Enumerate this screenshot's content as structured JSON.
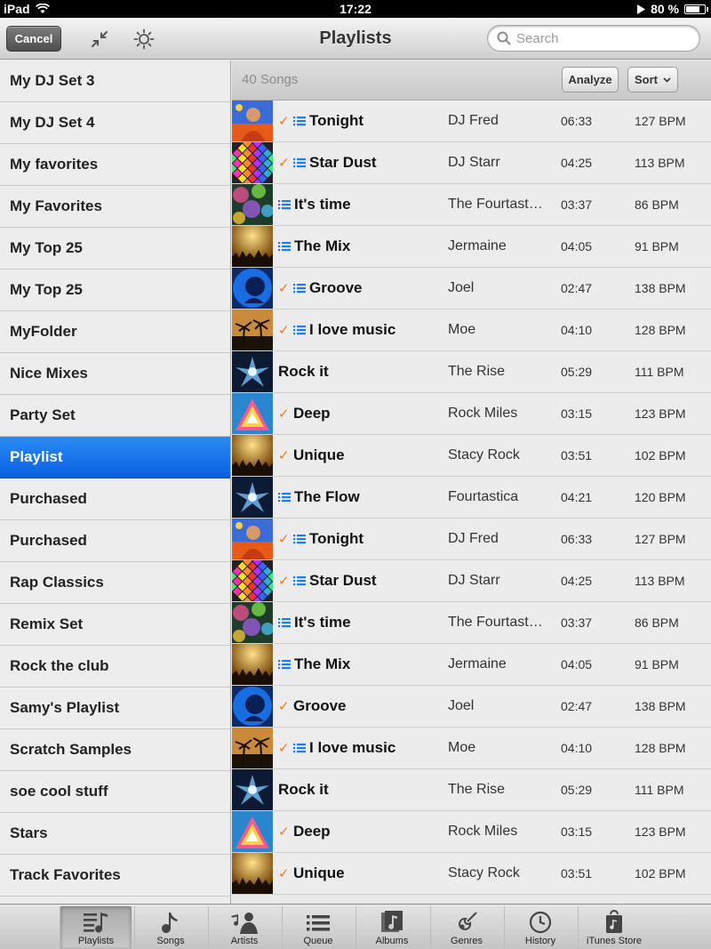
{
  "status": {
    "device": "iPad",
    "time": "17:22",
    "battery": "80 %",
    "battery_level": 0.8
  },
  "nav": {
    "cancel_label": "Cancel",
    "title": "Playlists",
    "search_placeholder": "Search"
  },
  "sidebar": {
    "items": [
      {
        "label": "My DJ Set 3"
      },
      {
        "label": "My DJ Set 4"
      },
      {
        "label": "My favorites"
      },
      {
        "label": "My Favorites"
      },
      {
        "label": "My Top 25"
      },
      {
        "label": "My Top 25"
      },
      {
        "label": "MyFolder"
      },
      {
        "label": "Nice Mixes"
      },
      {
        "label": "Party Set"
      },
      {
        "label": "Playlist",
        "selected": true
      },
      {
        "label": "Purchased"
      },
      {
        "label": "Purchased"
      },
      {
        "label": "Rap Classics"
      },
      {
        "label": "Remix Set"
      },
      {
        "label": "Rock the club"
      },
      {
        "label": "Samy's Playlist"
      },
      {
        "label": "Scratch Samples"
      },
      {
        "label": "soe cool stuff"
      },
      {
        "label": "Stars"
      },
      {
        "label": "Track Favorites"
      }
    ]
  },
  "main": {
    "song_count": "40 Songs",
    "analyze_label": "Analyze",
    "sort_label": "Sort",
    "songs": [
      {
        "title": "Tonight",
        "artist": "DJ Fred",
        "duration": "06:33",
        "bpm": "127 BPM",
        "checked": true,
        "listed": true,
        "art": "person-orange"
      },
      {
        "title": "Star Dust",
        "artist": "DJ Starr",
        "duration": "04:25",
        "bpm": "113 BPM",
        "checked": true,
        "listed": true,
        "art": "mosaic"
      },
      {
        "title": "It's time",
        "artist": "The Fourtast…",
        "duration": "03:37",
        "bpm": "86 BPM",
        "checked": false,
        "listed": true,
        "art": "bokeh"
      },
      {
        "title": "The Mix",
        "artist": "Jermaine",
        "duration": "04:05",
        "bpm": "91 BPM",
        "checked": false,
        "listed": true,
        "art": "crowd"
      },
      {
        "title": "Groove",
        "artist": "Joel",
        "duration": "02:47",
        "bpm": "138 BPM",
        "checked": true,
        "listed": true,
        "art": "blue-head"
      },
      {
        "title": "I love music",
        "artist": "Moe",
        "duration": "04:10",
        "bpm": "128 BPM",
        "checked": true,
        "listed": true,
        "art": "palms"
      },
      {
        "title": "Rock it",
        "artist": "The Rise",
        "duration": "05:29",
        "bpm": "111 BPM",
        "checked": false,
        "listed": false,
        "art": "splash"
      },
      {
        "title": "Deep",
        "artist": "Rock Miles",
        "duration": "03:15",
        "bpm": "123 BPM",
        "checked": true,
        "listed": false,
        "art": "triangle"
      },
      {
        "title": "Unique",
        "artist": "Stacy Rock",
        "duration": "03:51",
        "bpm": "102 BPM",
        "checked": true,
        "listed": false,
        "art": "crowd"
      },
      {
        "title": "The Flow",
        "artist": "Fourtastica",
        "duration": "04:21",
        "bpm": "120 BPM",
        "checked": false,
        "listed": true,
        "art": "splash"
      },
      {
        "title": "Tonight",
        "artist": "DJ Fred",
        "duration": "06:33",
        "bpm": "127 BPM",
        "checked": true,
        "listed": true,
        "art": "person-orange"
      },
      {
        "title": "Star Dust",
        "artist": "DJ Starr",
        "duration": "04:25",
        "bpm": "113 BPM",
        "checked": true,
        "listed": true,
        "art": "mosaic"
      },
      {
        "title": "It's time",
        "artist": "The Fourtast…",
        "duration": "03:37",
        "bpm": "86 BPM",
        "checked": false,
        "listed": true,
        "art": "bokeh"
      },
      {
        "title": "The Mix",
        "artist": "Jermaine",
        "duration": "04:05",
        "bpm": "91 BPM",
        "checked": false,
        "listed": true,
        "art": "crowd"
      },
      {
        "title": "Groove",
        "artist": "Joel",
        "duration": "02:47",
        "bpm": "138 BPM",
        "checked": true,
        "listed": false,
        "art": "blue-head"
      },
      {
        "title": "I love music",
        "artist": "Moe",
        "duration": "04:10",
        "bpm": "128 BPM",
        "checked": true,
        "listed": true,
        "art": "palms"
      },
      {
        "title": "Rock it",
        "artist": "The Rise",
        "duration": "05:29",
        "bpm": "111 BPM",
        "checked": false,
        "listed": false,
        "art": "splash"
      },
      {
        "title": "Deep",
        "artist": "Rock Miles",
        "duration": "03:15",
        "bpm": "123 BPM",
        "checked": true,
        "listed": false,
        "art": "triangle"
      },
      {
        "title": "Unique",
        "artist": "Stacy Rock",
        "duration": "03:51",
        "bpm": "102 BPM",
        "checked": true,
        "listed": false,
        "art": "crowd"
      }
    ]
  },
  "tabs": [
    {
      "label": "Playlists",
      "icon": "playlists-icon",
      "selected": true
    },
    {
      "label": "Songs",
      "icon": "note-icon"
    },
    {
      "label": "Artists",
      "icon": "artist-icon"
    },
    {
      "label": "Queue",
      "icon": "queue-icon"
    },
    {
      "label": "Albums",
      "icon": "album-icon"
    },
    {
      "label": "Genres",
      "icon": "guitar-icon"
    },
    {
      "label": "History",
      "icon": "clock-icon"
    },
    {
      "label": "iTunes Store",
      "icon": "store-icon"
    }
  ],
  "colors": {
    "accent": "#0b5fe0",
    "check": "#f07a14",
    "list_icon": "#1e7bf0"
  }
}
